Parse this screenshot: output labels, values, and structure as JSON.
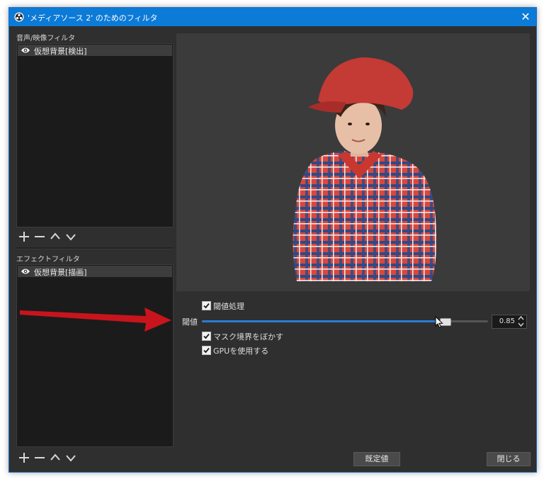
{
  "window": {
    "title": "'メディアソース 2' のためのフィルタ",
    "close_glyph": "✕"
  },
  "audio_video_filters": {
    "label": "音声/映像フィルタ",
    "items": [
      {
        "label": "仮想背景[検出]",
        "visible": true
      }
    ]
  },
  "effect_filters": {
    "label": "エフェクトフィルタ",
    "items": [
      {
        "label": "仮想背景[描画]",
        "visible": true
      }
    ]
  },
  "toolbar_icons": [
    "plus-icon",
    "minus-icon",
    "chevron-up-icon",
    "chevron-down-icon"
  ],
  "properties": {
    "threshold_processing": {
      "label": "閾値処理",
      "checked": true
    },
    "threshold": {
      "label": "閾値",
      "value": "0.85",
      "level": 0.85
    },
    "blur_mask_edges": {
      "label": "マスク境界をぼかす",
      "checked": true
    },
    "use_gpu": {
      "label": "GPUを使用する",
      "checked": true
    }
  },
  "buttons": {
    "defaults": "既定値",
    "close": "閉じる"
  },
  "colors": {
    "titlebar": "#0c7ad7",
    "window_bg": "#2f2f2f",
    "slider_fill": "#2c7ad6",
    "annotation_arrow": "#c8141c"
  }
}
